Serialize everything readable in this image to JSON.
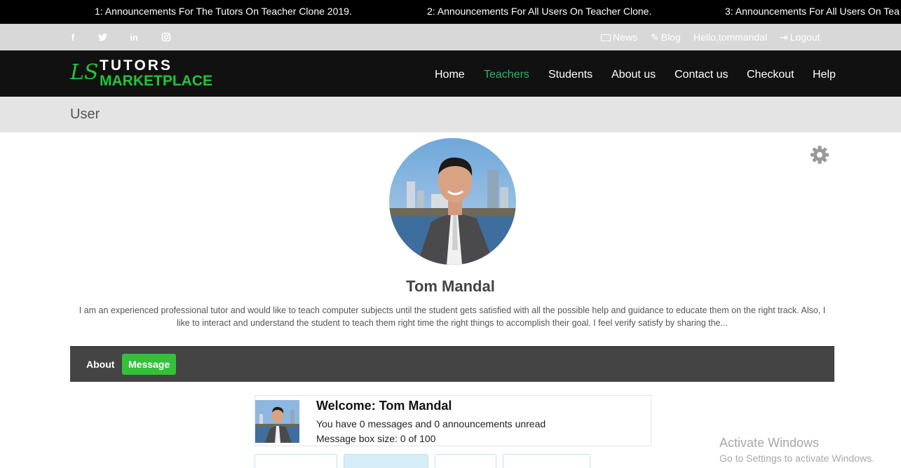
{
  "ticker": [
    "1: Announcements For The Tutors On Teacher Clone 2019.",
    "2: Announcements For All Users On Teacher Clone.",
    "3: Announcements For All Users On Tea"
  ],
  "topbar": {
    "social": [
      "f",
      "t",
      "in",
      "ig"
    ],
    "news_label": "News",
    "blog_label": "Blog",
    "greeting": "Hello,tommandal",
    "logout_label": "Logout"
  },
  "logo": {
    "mark": "LS",
    "line1": "TUTORS",
    "line2": "MARKETPLACE"
  },
  "nav": [
    {
      "label": "Home"
    },
    {
      "label": "Teachers"
    },
    {
      "label": "Students"
    },
    {
      "label": "About us"
    },
    {
      "label": "Contact us"
    },
    {
      "label": "Checkout"
    },
    {
      "label": "Help"
    }
  ],
  "page_title": "User",
  "profile": {
    "name": "Tom Mandal",
    "bio_line1": "I am an experienced professional tutor and would like to teach computer subjects until the student gets satisfied with all the possible help and guidance to educate them on the right track. Also, I",
    "bio_line2": "like to interact and understand the student to teach them right time the right things to accomplish their goal. I feel verify satisfy by sharing the..."
  },
  "tabs": {
    "about": "About",
    "message": "Message"
  },
  "welcome": {
    "title": "Welcome: Tom Mandal",
    "unread": "You have 0 messages and 0 announcements unread",
    "box_size": "Message box size: 0 of 100"
  },
  "watermark": {
    "line1": "Activate Windows",
    "line2": "Go to Settings to activate Windows."
  },
  "colors": {
    "accent_green": "#21c43a",
    "nav_active": "#2fb368",
    "message_button": "#33c13a"
  }
}
